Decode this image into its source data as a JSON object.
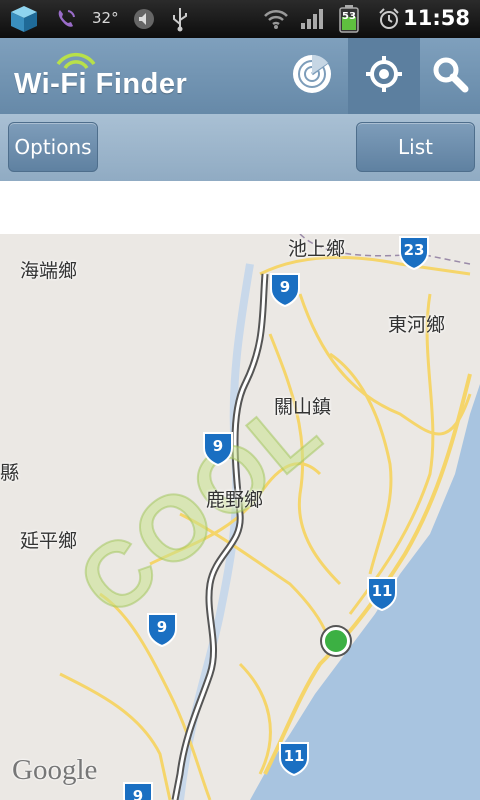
{
  "status_bar": {
    "temperature": "32°",
    "battery": "53",
    "time": "11:58",
    "icons": [
      "app-cube-icon",
      "viber-phone-icon",
      "volume-icon",
      "usb-icon",
      "wifi-icon",
      "signal-icon",
      "battery-icon",
      "alarm-icon"
    ]
  },
  "app_bar": {
    "title": "Wi-Fi Finder",
    "buttons": [
      "radar-icon",
      "locate-icon",
      "search-icon"
    ]
  },
  "toolbar": {
    "options_label": "Options",
    "list_label": "List"
  },
  "map": {
    "places": {
      "chishang": "池上鄉",
      "haiduan": "海端鄉",
      "donghe": "東河鄉",
      "guanshan": "關山鎮",
      "xian": "縣",
      "luye": "鹿野鄉",
      "yanping": "延平鄉"
    },
    "routes": {
      "r9a": "9",
      "r9b": "9",
      "r9c": "9",
      "r9d": "9",
      "r23": "23",
      "r11a": "11",
      "r11b": "11"
    },
    "watermark": "COOL",
    "attribution": "Google",
    "colors": {
      "land": "#ebe8e4",
      "sea": "#a8c4e0",
      "road": "#f5d56a",
      "shield": "#1a6fc2"
    }
  }
}
